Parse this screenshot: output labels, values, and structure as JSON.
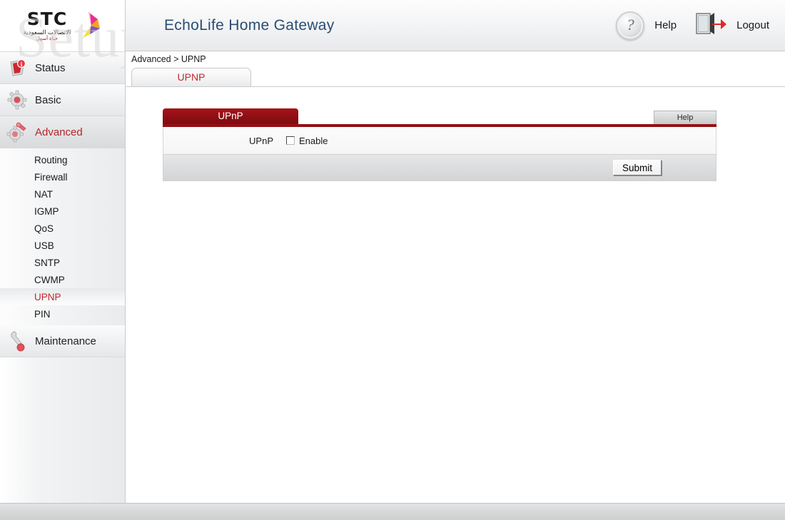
{
  "watermark": {
    "text": "SetupRouter.com"
  },
  "branding": {
    "logo_name": "STC",
    "logo_arabic_primary": "الاتصالات السعودية",
    "logo_arabic_secondary": "حياة أسهل",
    "logo_icon": "stc-swirl-icon"
  },
  "header": {
    "title": "EchoLife Home Gateway",
    "help_label": "Help",
    "help_icon": "question-mark-circle-icon",
    "logout_label": "Logout",
    "logout_icon": "door-exit-arrow-icon"
  },
  "breadcrumb": {
    "text": "Advanced > UPNP"
  },
  "tabs": [
    {
      "label": "UPNP",
      "active": true
    }
  ],
  "sidebar": {
    "sections": [
      {
        "label": "Status",
        "icon": "info-document-icon",
        "active": false
      },
      {
        "label": "Basic",
        "icon": "gear-icon",
        "active": false
      },
      {
        "label": "Advanced",
        "icon": "gear-wrench-icon",
        "active": true
      }
    ],
    "sub_items": [
      {
        "label": "Routing",
        "active": false
      },
      {
        "label": "Firewall",
        "active": false
      },
      {
        "label": "NAT",
        "active": false
      },
      {
        "label": "IGMP",
        "active": false
      },
      {
        "label": "QoS",
        "active": false
      },
      {
        "label": "USB",
        "active": false
      },
      {
        "label": "SNTP",
        "active": false
      },
      {
        "label": "CWMP",
        "active": false
      },
      {
        "label": "UPNP",
        "active": true
      },
      {
        "label": "PIN",
        "active": false
      }
    ],
    "maintenance": {
      "label": "Maintenance",
      "icon": "wrench-icon",
      "active": false
    }
  },
  "panel": {
    "tab_label": "UPnP",
    "help_label": "Help",
    "field_label": "UPnP",
    "checkbox_label": "Enable",
    "checkbox_checked": false,
    "submit_label": "Submit"
  },
  "colors": {
    "panel_red": "#9e1016",
    "accent_red": "#c0282e",
    "title_blue": "#2a4d73"
  }
}
